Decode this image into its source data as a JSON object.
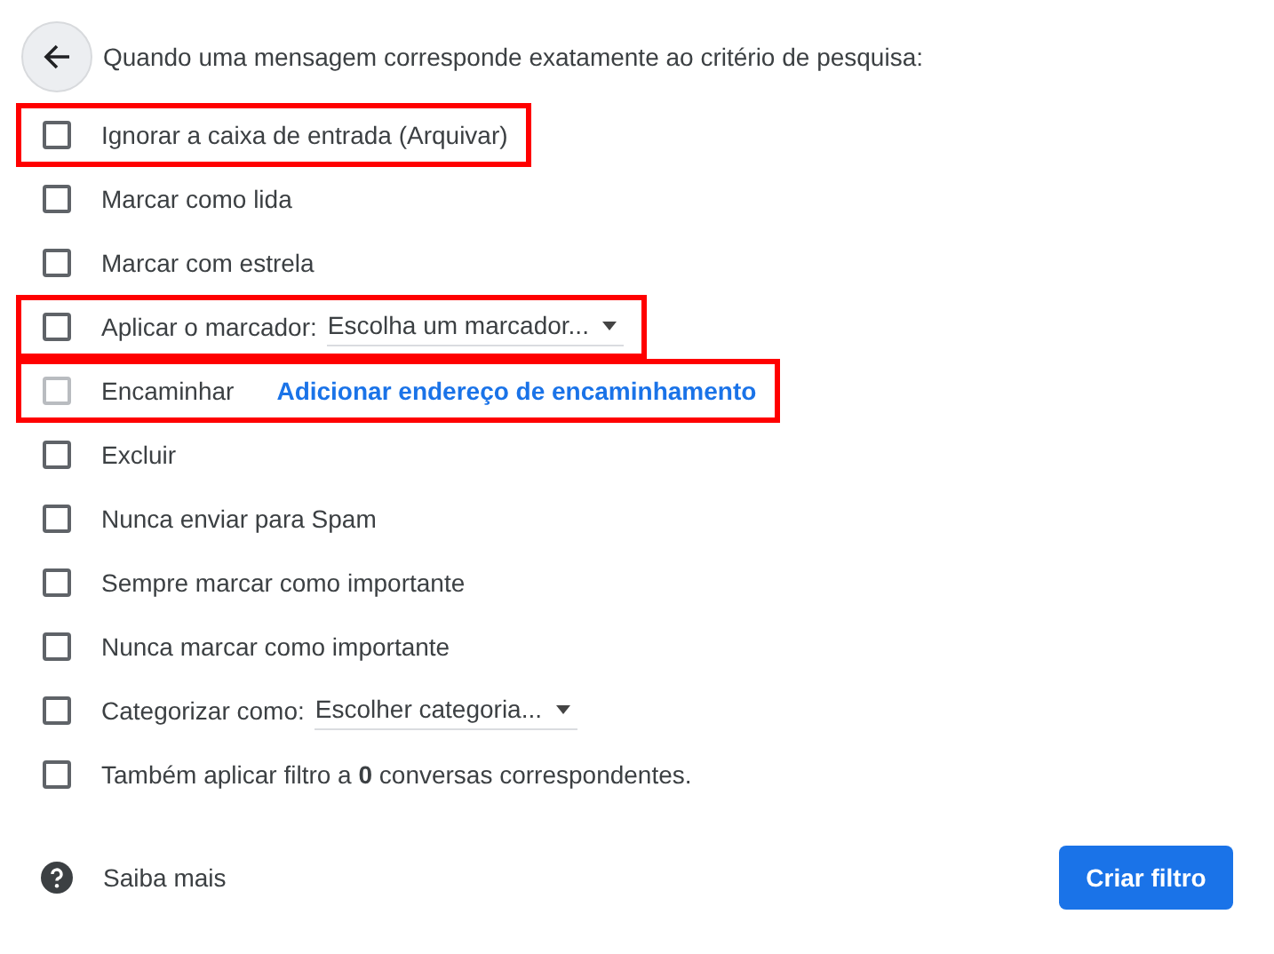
{
  "header": {
    "text": "Quando uma mensagem corresponde exatamente ao critério de pesquisa:"
  },
  "options": [
    {
      "kind": "plain",
      "label": "Ignorar a caixa de entrada (Arquivar)",
      "checked": false,
      "disabled": false,
      "highlighted": true
    },
    {
      "kind": "plain",
      "label": "Marcar como lida",
      "checked": false,
      "disabled": false,
      "highlighted": false
    },
    {
      "kind": "plain",
      "label": "Marcar com estrela",
      "checked": false,
      "disabled": false,
      "highlighted": false
    },
    {
      "kind": "dropdown",
      "label": "Aplicar o marcador:",
      "value": "Escolha um marcador...",
      "checked": false,
      "disabled": false,
      "highlighted": true
    },
    {
      "kind": "link",
      "label": "Encaminhar",
      "link": "Adicionar endereço de encaminhamento",
      "checked": false,
      "disabled": true,
      "highlighted": true
    },
    {
      "kind": "plain",
      "label": "Excluir",
      "checked": false,
      "disabled": false,
      "highlighted": false
    },
    {
      "kind": "plain",
      "label": "Nunca enviar para Spam",
      "checked": false,
      "disabled": false,
      "highlighted": false
    },
    {
      "kind": "plain",
      "label": "Sempre marcar como importante",
      "checked": false,
      "disabled": false,
      "highlighted": false
    },
    {
      "kind": "plain",
      "label": "Nunca marcar como importante",
      "checked": false,
      "disabled": false,
      "highlighted": false
    },
    {
      "kind": "dropdown",
      "label": "Categorizar como:",
      "value": "Escolher categoria...",
      "checked": false,
      "disabled": false,
      "highlighted": false
    },
    {
      "kind": "plain",
      "label": "Também aplicar filtro a **0** conversas correspondentes.",
      "checked": false,
      "disabled": false,
      "highlighted": false
    }
  ],
  "footer": {
    "help": "Saiba mais",
    "button": "Criar filtro"
  }
}
